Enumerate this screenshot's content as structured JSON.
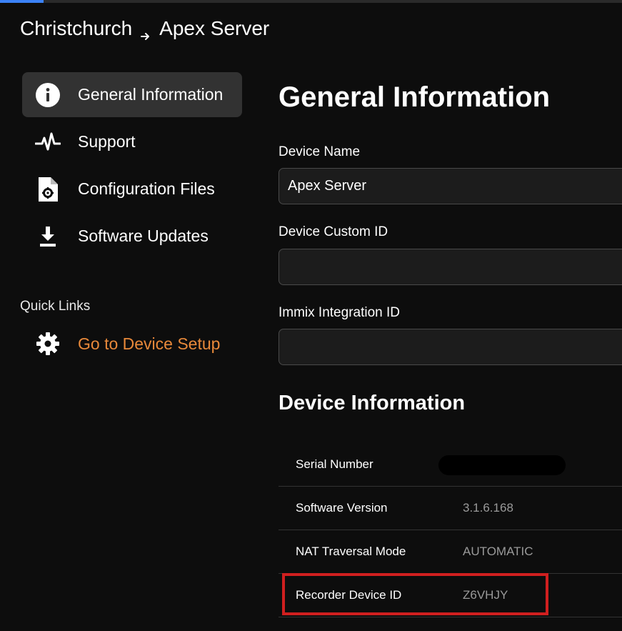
{
  "header": {
    "progress_fraction": 0.07,
    "breadcrumb": [
      "Christchurch",
      "Apex Server"
    ],
    "breadcrumb_separator_icon": "arrow-right-icon"
  },
  "sidebar": {
    "items": [
      {
        "label": "General Information",
        "icon": "info-circle-icon",
        "active": true
      },
      {
        "label": "Support",
        "icon": "pulse-icon",
        "active": false
      },
      {
        "label": "Configuration Files",
        "icon": "file-gear-icon",
        "active": false
      },
      {
        "label": "Software Updates",
        "icon": "download-icon",
        "active": false
      }
    ]
  },
  "quick_links": {
    "title": "Quick Links",
    "items": [
      {
        "label": "Go to Device Setup",
        "icon": "gear-icon",
        "color": "#e8893a"
      }
    ]
  },
  "main": {
    "title": "General Information",
    "fields": [
      {
        "label": "Device Name",
        "value": "Apex Server",
        "placeholder": ""
      },
      {
        "label": "Device Custom ID",
        "value": "",
        "placeholder": ""
      },
      {
        "label": "Immix Integration ID",
        "value": "",
        "placeholder": ""
      }
    ],
    "device_info": {
      "title": "Device Information",
      "rows": [
        {
          "key": "Serial Number",
          "value": "",
          "redacted": true
        },
        {
          "key": "Software Version",
          "value": "3.1.6.168"
        },
        {
          "key": "NAT Traversal Mode",
          "value": "AUTOMATIC"
        },
        {
          "key": "Recorder Device ID",
          "value": "Z6VHJY",
          "highlighted": true
        }
      ]
    }
  },
  "colors": {
    "background": "#0d0d0d",
    "active_nav": "#323232",
    "accent_link": "#e8893a",
    "highlight_border": "#d01f1f",
    "progress": "#3b82f6"
  }
}
